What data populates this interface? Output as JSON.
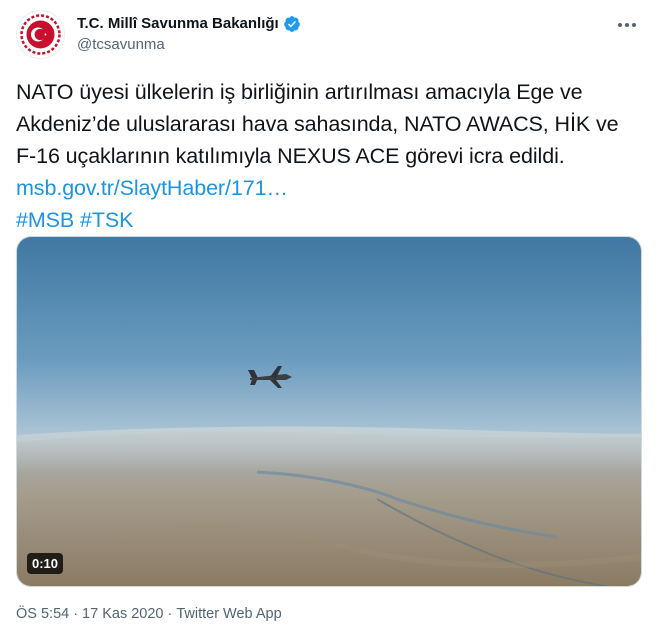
{
  "author": {
    "display_name": "T.C. Millî Savunma Bakanlığı",
    "handle": "@tcsavunma",
    "verified": true,
    "avatar_icon": "ministry-crest-icon",
    "brand_color": "#c8102e"
  },
  "tweet": {
    "lines": [
      "NATO üyesi ülkelerin iş birliğinin artırılması amacıyla Ege ve",
      "Akdeniz’de uluslararası hava sahasında, NATO AWACS, HİK ve",
      "F-16 uçaklarının katılımıyla NEXUS ACE görevi icra edildi."
    ],
    "link": "msb.gov.tr/SlaytHaber/171…",
    "hashtags": [
      "#MSB",
      "#TSK"
    ]
  },
  "media": {
    "type": "video",
    "duration": "0:10"
  },
  "meta": {
    "time": "ÖS 5:54",
    "separator": "·",
    "date": "17 Kas 2020",
    "source": "Twitter Web App"
  },
  "colors": {
    "link": "#1b95e0",
    "text": "#0f1419",
    "secondary": "#536471",
    "verified": "#1d9bf0"
  }
}
